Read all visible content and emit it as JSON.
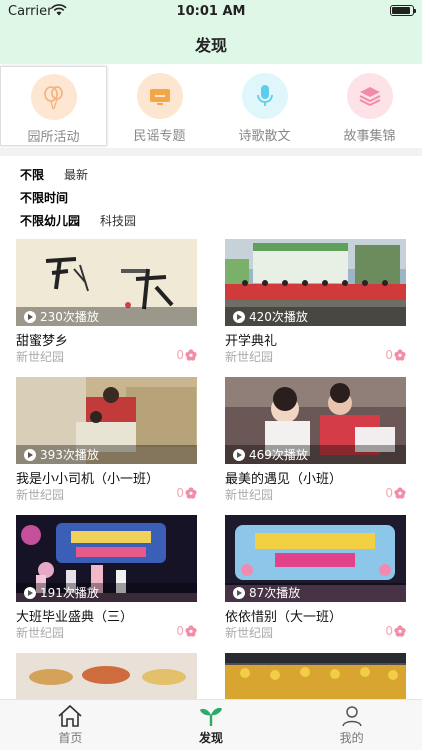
{
  "status": {
    "carrier": "Carrier",
    "time": "10:01 AM"
  },
  "nav": {
    "title": "发现"
  },
  "categories": [
    {
      "label": "园所活动",
      "icon": "balloons-icon"
    },
    {
      "label": "民谣专题",
      "icon": "tv-icon"
    },
    {
      "label": "诗歌散文",
      "icon": "microphone-icon"
    },
    {
      "label": "故事集锦",
      "icon": "layers-icon"
    }
  ],
  "filters": {
    "row1": [
      "不限",
      "最新"
    ],
    "row2": [
      "不限时间"
    ],
    "row3": [
      "不限幼儿园",
      "科技园"
    ]
  },
  "cards": [
    {
      "title": "甜蜜梦乡",
      "school": "新世纪园",
      "plays": "230次播放",
      "likes": "0"
    },
    {
      "title": "开学典礼",
      "school": "新世纪园",
      "plays": "420次播放",
      "likes": "0"
    },
    {
      "title": "我是小小司机（小一班）",
      "school": "新世纪园",
      "plays": "393次播放",
      "likes": "0"
    },
    {
      "title": "最美的遇见（小班）",
      "school": "新世纪园",
      "plays": "469次播放",
      "likes": "0"
    },
    {
      "title": "大班毕业盛典（三）",
      "school": "新世纪园",
      "plays": "191次播放",
      "likes": "0"
    },
    {
      "title": "依依惜别（大一班）",
      "school": "新世纪园",
      "plays": "87次播放",
      "likes": "0"
    }
  ],
  "tabs": [
    {
      "label": "首页",
      "icon": "home-icon"
    },
    {
      "label": "发现",
      "icon": "sprout-icon"
    },
    {
      "label": "我的",
      "icon": "user-icon"
    }
  ],
  "colors": {
    "header_bg": "#dff7e6",
    "like_pink": "#f3a6b8",
    "active_tab_green": "#2fa86a"
  }
}
